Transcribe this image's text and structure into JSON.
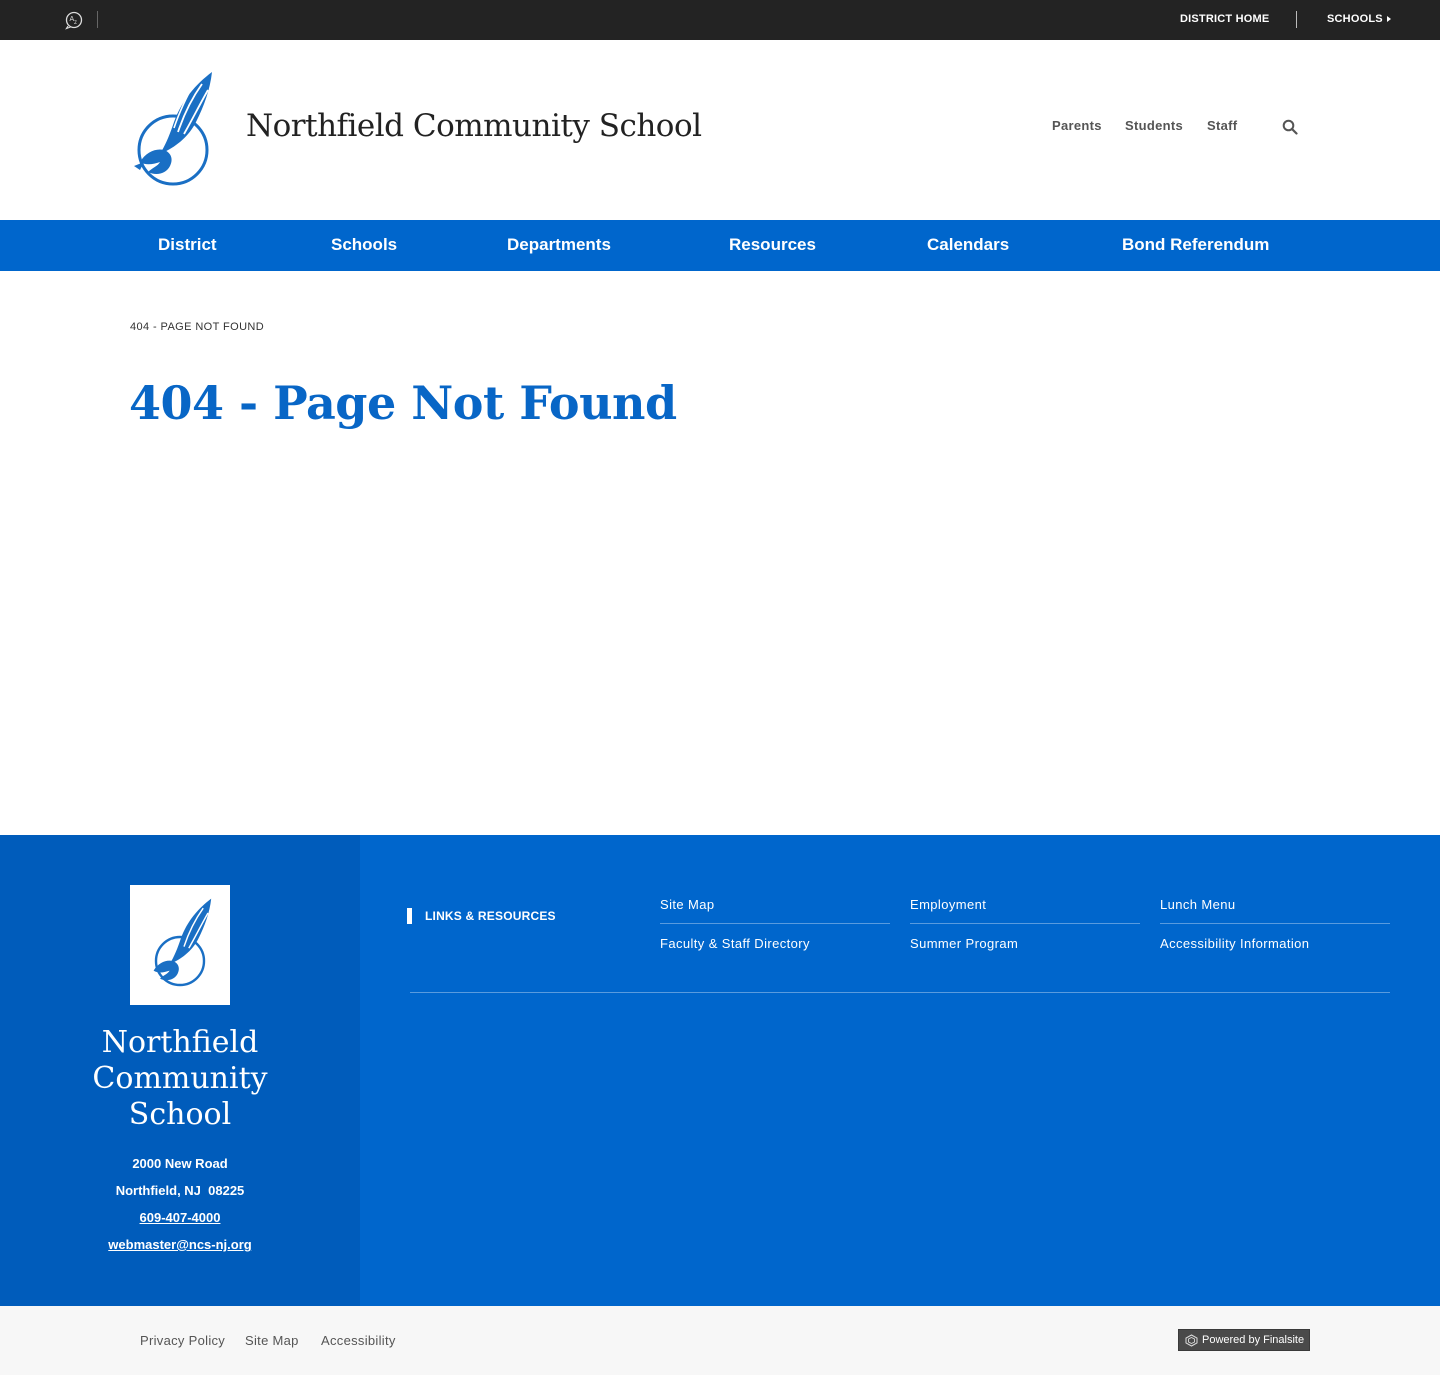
{
  "topbar": {
    "translate_icon": "translate-icon",
    "district_home": "DISTRICT HOME",
    "schools": "SCHOOLS"
  },
  "header": {
    "school_name": "Northfield Community School",
    "logo_icon": "hawk-logo",
    "audience_links": [
      "Parents",
      "Students",
      "Staff"
    ],
    "search_icon": "search-icon"
  },
  "mainnav": {
    "items": [
      "District",
      "Schools",
      "Departments",
      "Resources",
      "Calendars",
      "Bond Referendum"
    ]
  },
  "content": {
    "breadcrumb": "404 - PAGE NOT FOUND",
    "title": "404 - Page Not Found"
  },
  "footer": {
    "school_name_lines": [
      "Northfield",
      "Community",
      "School"
    ],
    "address_line1": "2000 New Road",
    "address_line2": "Northfield, NJ  08225",
    "phone": "609-407-4000",
    "email": "webmaster@ncs-nj.org",
    "links_heading": "LINKS & RESOURCES",
    "links": [
      [
        "Site Map",
        "Employment",
        "Lunch Menu"
      ],
      [
        "Faculty & Staff Directory",
        "Summer Program",
        "Accessibility Information"
      ]
    ]
  },
  "bottombar": {
    "links": [
      "Privacy Policy",
      "Site Map",
      "Accessibility"
    ],
    "powered_by": "Powered by Finalsite"
  },
  "colors": {
    "brand_blue": "#0066cc",
    "title_blue": "#0866c6",
    "footer_left_blue": "#005cbb",
    "topbar_bg": "#232323"
  }
}
